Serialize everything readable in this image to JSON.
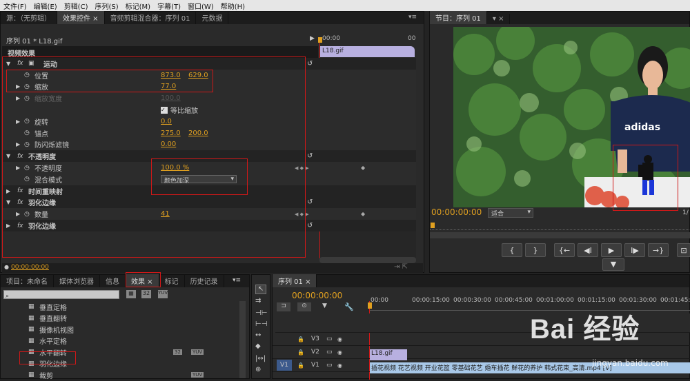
{
  "menu": [
    "文件(F)",
    "编辑(E)",
    "剪辑(C)",
    "序列(S)",
    "标记(M)",
    "字幕(T)",
    "窗口(W)",
    "帮助(H)"
  ],
  "top_tabs": [
    "源：（无剪辑）",
    "效果控件",
    "音频剪辑混合器：序列 01",
    "元数据"
  ],
  "ec": {
    "clip_path": "序列 01 * L18.gif",
    "ruler_time": "00:00",
    "clip_name": "L18.gif",
    "section": "视频效果",
    "current_time": "00:00:00:00",
    "rows": [
      {
        "indent": 0,
        "expand": "▼",
        "fx": "fx",
        "name": "运动",
        "bold": true,
        "v1": "",
        "v2": ""
      },
      {
        "indent": 1,
        "expand": "",
        "fx": "",
        "name": "位置",
        "v1": "873.0",
        "v2": "629.0"
      },
      {
        "indent": 1,
        "expand": "▶",
        "fx": "",
        "name": "缩放",
        "v1": "77.0",
        "v2": ""
      },
      {
        "indent": 1,
        "expand": "▶",
        "fx": "",
        "name": "缩放宽度",
        "v1": "100.0",
        "v2": "",
        "dim": true
      },
      {
        "indent": 1,
        "expand": "",
        "fx": "",
        "name": "",
        "check": "等比缩放",
        "v1": "",
        "v2": ""
      },
      {
        "indent": 1,
        "expand": "▶",
        "fx": "",
        "name": "旋转",
        "v1": "0.0",
        "v2": ""
      },
      {
        "indent": 1,
        "expand": "",
        "fx": "",
        "name": "锚点",
        "v1": "275.0",
        "v2": "200.0"
      },
      {
        "indent": 1,
        "expand": "▶",
        "fx": "",
        "name": "防闪烁滤镜",
        "v1": "0.00",
        "v2": ""
      },
      {
        "indent": 0,
        "expand": "▼",
        "fx": "fx",
        "name": "不透明度",
        "bold": true,
        "v1": "",
        "v2": ""
      },
      {
        "indent": 1,
        "expand": "▶",
        "fx": "",
        "name": "不透明度",
        "v1": "100.0 %",
        "v2": ""
      },
      {
        "indent": 1,
        "expand": "",
        "fx": "",
        "name": "混合模式",
        "select": "颜色加深",
        "v1": "",
        "v2": ""
      },
      {
        "indent": 0,
        "expand": "▶",
        "fx": "fx",
        "name": "时间重映射",
        "bold": true,
        "v1": "",
        "v2": ""
      },
      {
        "indent": 0,
        "expand": "▼",
        "fx": "fx",
        "name": "羽化边缘",
        "bold": true,
        "v1": "",
        "v2": ""
      },
      {
        "indent": 1,
        "expand": "▶",
        "fx": "",
        "name": "数量",
        "v1": "41",
        "v2": ""
      },
      {
        "indent": 0,
        "expand": "▶",
        "fx": "fx",
        "name": "羽化边缘",
        "bold": true,
        "v1": "",
        "v2": ""
      }
    ]
  },
  "program": {
    "tab": "节目：序列 01",
    "time": "00:00:00:00",
    "fit": "适合",
    "fraction": "1/",
    "shirt_text": "adidas"
  },
  "project_tabs": [
    "项目：未命名",
    "媒体浏览器",
    "信息",
    "效果",
    "标记",
    "历史记录"
  ],
  "effects_list": [
    "垂直定格",
    "垂直翻转",
    "摄像机视图",
    "水平定格",
    "水平翻转",
    "羽化边缘",
    "裁剪"
  ],
  "effect_badges": [
    "32",
    "32",
    "YUV"
  ],
  "timeline": {
    "tab": "序列 01",
    "time": "00:00:00:00",
    "ruler": [
      "00:00",
      "00:00:15:00",
      "00:00:30:00",
      "00:00:45:00",
      "00:01:00:00",
      "00:01:15:00",
      "00:01:30:00",
      "00:01:45:00"
    ],
    "tracks": [
      "V3",
      "V2",
      "V1"
    ],
    "clip_v2": "L18.gif",
    "clip_v1": "插花视频 花艺视频 开业花篮 零基础花艺 婚车插花 鲜花的养护 韩式花束_高清.mp4 [V]"
  },
  "watermark": "Bai 经验",
  "watermark_url": "jingyan.baidu.com",
  "colors": {
    "accent": "#e0a020",
    "red": "#d01818",
    "clip_purple": "#b8b0e0",
    "clip_blue": "#a8c8e8"
  }
}
